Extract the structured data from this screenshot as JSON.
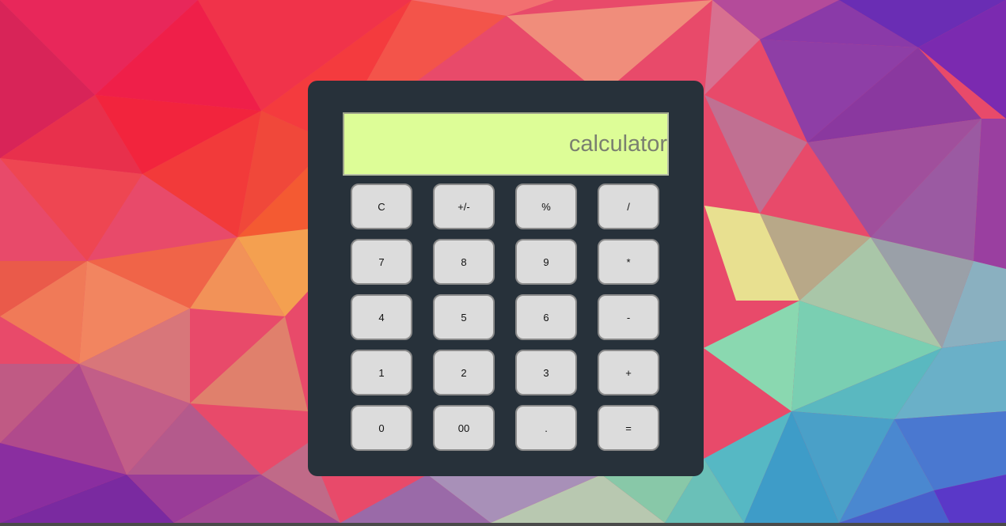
{
  "display": {
    "placeholder": "calculator",
    "value": ""
  },
  "keys": [
    [
      "C",
      "+/-",
      "%",
      "/"
    ],
    [
      "7",
      "8",
      "9",
      "*"
    ],
    [
      "4",
      "5",
      "6",
      "-"
    ],
    [
      "1",
      "2",
      "3",
      "+"
    ],
    [
      "0",
      "00",
      ".",
      "="
    ]
  ],
  "colors": {
    "calculator_body": "#27313a",
    "display_background": "#ddfd97",
    "key_background": "#dcdcdc"
  }
}
